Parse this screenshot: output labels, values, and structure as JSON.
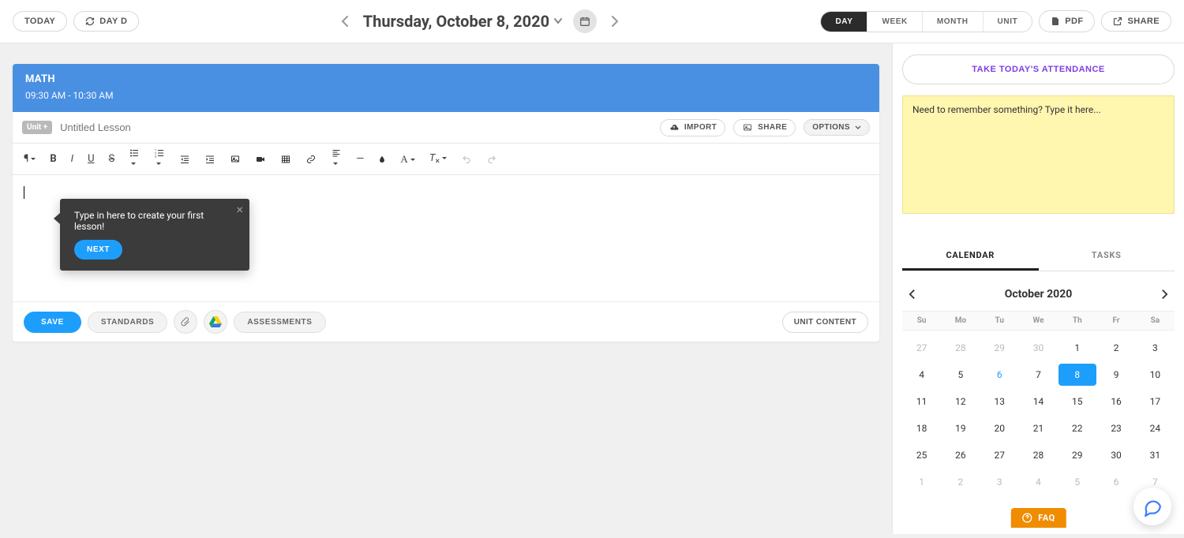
{
  "top": {
    "today": "TODAY",
    "dayd": "DAY D",
    "date": "Thursday, October 8, 2020",
    "views": [
      "DAY",
      "WEEK",
      "MONTH",
      "UNIT"
    ],
    "active_view": "DAY",
    "pdf": "PDF",
    "share": "SHARE"
  },
  "lesson": {
    "subject": "MATH",
    "time": "09:30 AM - 10:30 AM",
    "unit_chip": "Unit +",
    "title_placeholder": "Untitled Lesson",
    "import": "IMPORT",
    "share": "SHARE",
    "options": "OPTIONS",
    "save": "SAVE",
    "standards": "STANDARDS",
    "assessments": "ASSESSMENTS",
    "unit_content": "UNIT CONTENT"
  },
  "tooltip": {
    "msg": "Type in here to create your first lesson!",
    "next": "NEXT"
  },
  "side": {
    "attendance": "TAKE TODAY'S ATTENDANCE",
    "note_placeholder": "Need to remember something? Type it here...",
    "tabs": {
      "calendar": "CALENDAR",
      "tasks": "TASKS"
    },
    "faq": "FAQ"
  },
  "calendar": {
    "title": "October 2020",
    "dow": [
      "Su",
      "Mo",
      "Tu",
      "We",
      "Th",
      "Fr",
      "Sa"
    ],
    "today": 8,
    "days": [
      {
        "n": 27,
        "dim": true
      },
      {
        "n": 28,
        "dim": true
      },
      {
        "n": 29,
        "dim": true
      },
      {
        "n": 30,
        "dim": true
      },
      {
        "n": 1
      },
      {
        "n": 2
      },
      {
        "n": 3
      },
      {
        "n": 4
      },
      {
        "n": 5
      },
      {
        "n": 6,
        "link": true
      },
      {
        "n": 7
      },
      {
        "n": 8,
        "active": true
      },
      {
        "n": 9
      },
      {
        "n": 10
      },
      {
        "n": 11
      },
      {
        "n": 12
      },
      {
        "n": 13
      },
      {
        "n": 14
      },
      {
        "n": 15
      },
      {
        "n": 16
      },
      {
        "n": 17
      },
      {
        "n": 18
      },
      {
        "n": 19
      },
      {
        "n": 20
      },
      {
        "n": 21
      },
      {
        "n": 22
      },
      {
        "n": 23
      },
      {
        "n": 24
      },
      {
        "n": 25
      },
      {
        "n": 26
      },
      {
        "n": 27
      },
      {
        "n": 28
      },
      {
        "n": 29
      },
      {
        "n": 30
      },
      {
        "n": 31
      },
      {
        "n": 1,
        "dim": true
      },
      {
        "n": 2,
        "dim": true
      },
      {
        "n": 3,
        "dim": true
      },
      {
        "n": 4,
        "dim": true
      },
      {
        "n": 5,
        "dim": true
      },
      {
        "n": 6,
        "dim": true
      },
      {
        "n": 7,
        "dim": true
      }
    ]
  }
}
